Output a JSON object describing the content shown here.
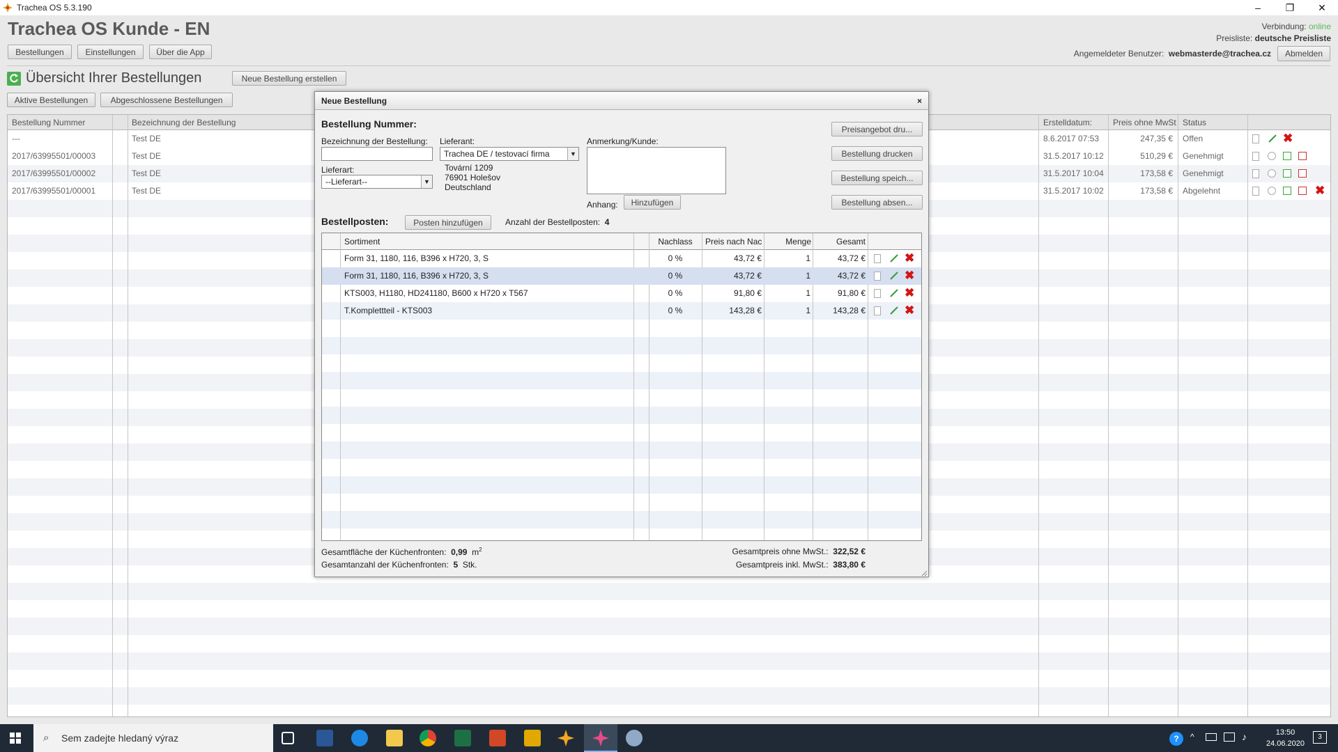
{
  "window": {
    "title": "Trachea OS 5.3.190"
  },
  "app": {
    "title": "Trachea OS Kunde - EN",
    "menu": [
      "Bestellungen",
      "Einstellungen",
      "Über die App"
    ],
    "connection_label": "Verbindung:",
    "connection_value": "online",
    "pricelist_label": "Preisliste:",
    "pricelist_value": "deutsche Preisliste",
    "user_label": "Angemeldeter Benutzer:",
    "user_value": "webmasterde@trachea.cz",
    "logout": "Abmelden",
    "colors": {
      "online": "#5cb85c",
      "delete": "#d21414"
    }
  },
  "overview": {
    "title": "Übersicht Ihrer Bestellungen",
    "new_order_button": "Neue Bestellung erstellen",
    "tabs": [
      "Aktive Bestellungen",
      "Abgeschlossene Bestellungen"
    ],
    "columns": {
      "number": "Bestellung Nummer",
      "name": "Bezeichnung der Bestellung",
      "created": "Erstelldatum:",
      "price": "Preis ohne MwSt",
      "status": "Status"
    },
    "rows": [
      {
        "number": "---",
        "name": "Test DE",
        "created": "8.6.2017 07:53",
        "price": "247,35 €",
        "status": "Offen"
      },
      {
        "number": "2017/63995501/00003",
        "name": "Test DE",
        "created": "31.5.2017 10:12",
        "price": "510,29 €",
        "status": "Genehmigt"
      },
      {
        "number": "2017/63995501/00002",
        "name": "Test DE",
        "created": "31.5.2017 10:04",
        "price": "173,58 €",
        "status": "Genehmigt"
      },
      {
        "number": "2017/63995501/00001",
        "name": "Test DE",
        "created": "31.5.2017 10:02",
        "price": "173,58 €",
        "status": "Abgelehnt"
      }
    ]
  },
  "dialog": {
    "title": "Neue Bestellung",
    "close": "×",
    "order_number_label": "Bestellung Nummer:",
    "name_label": "Bezeichnung der Bestellung:",
    "name_value": "",
    "supplier_label": "Lieferant:",
    "supplier_value": "Trachea DE / testovací firma",
    "supplier_address": [
      "Tovární 1209",
      "76901 Holešov",
      "Deutschland"
    ],
    "delivery_label": "Lieferart:",
    "delivery_value": "--Lieferart--",
    "note_label": "Anmerkung/Kunde:",
    "note_value": "",
    "attachment_label": "Anhang:",
    "attachment_button": "Hinzufügen",
    "actions": [
      "Preisangebot dru...",
      "Bestellung drucken",
      "Bestellung speich...",
      "Bestellung absen..."
    ],
    "items_label": "Bestellposten:",
    "add_item_button": "Posten hinzufügen",
    "items_count_label": "Anzahl der Bestellposten:",
    "items_count": "4",
    "columns": {
      "assortment": "Sortiment",
      "discount": "Nachlass",
      "price": "Preis nach Nac",
      "qty": "Menge",
      "total": "Gesamt"
    },
    "items": [
      {
        "assortment": "Form 31, 1180, 116, B396 x H720, 3, S",
        "discount": "0 %",
        "price": "43,72 €",
        "qty": "1",
        "total": "43,72 €"
      },
      {
        "assortment": "Form 31, 1180, 116, B396 x H720, 3, S",
        "discount": "0 %",
        "price": "43,72 €",
        "qty": "1",
        "total": "43,72 €"
      },
      {
        "assortment": "KTS003, H1180, HD241180, B600 x H720 x T567",
        "discount": "0 %",
        "price": "91,80 €",
        "qty": "1",
        "total": "91,80 €"
      },
      {
        "assortment": "T.Komplettteil - KTS003",
        "discount": "0 %",
        "price": "143,28 €",
        "qty": "1",
        "total": "143,28 €"
      }
    ],
    "summary": {
      "area_label": "Gesamtfläche der Küchenfronten:",
      "area_value": "0,99",
      "area_unit": "m",
      "area_sup": "2",
      "count_label": "Gesamtanzahl der Küchenfronten:",
      "count_value": "5",
      "count_unit": "Stk.",
      "net_label": "Gesamtpreis ohne MwSt.:",
      "net_value": "322,52 €",
      "gross_label": "Gesamtpreis inkl. MwSt.:",
      "gross_value": "383,80 €"
    }
  },
  "taskbar": {
    "search_placeholder": "Sem zadejte hledaný výraz",
    "time": "13:50",
    "date": "24.06.2020",
    "notifications": "3"
  }
}
